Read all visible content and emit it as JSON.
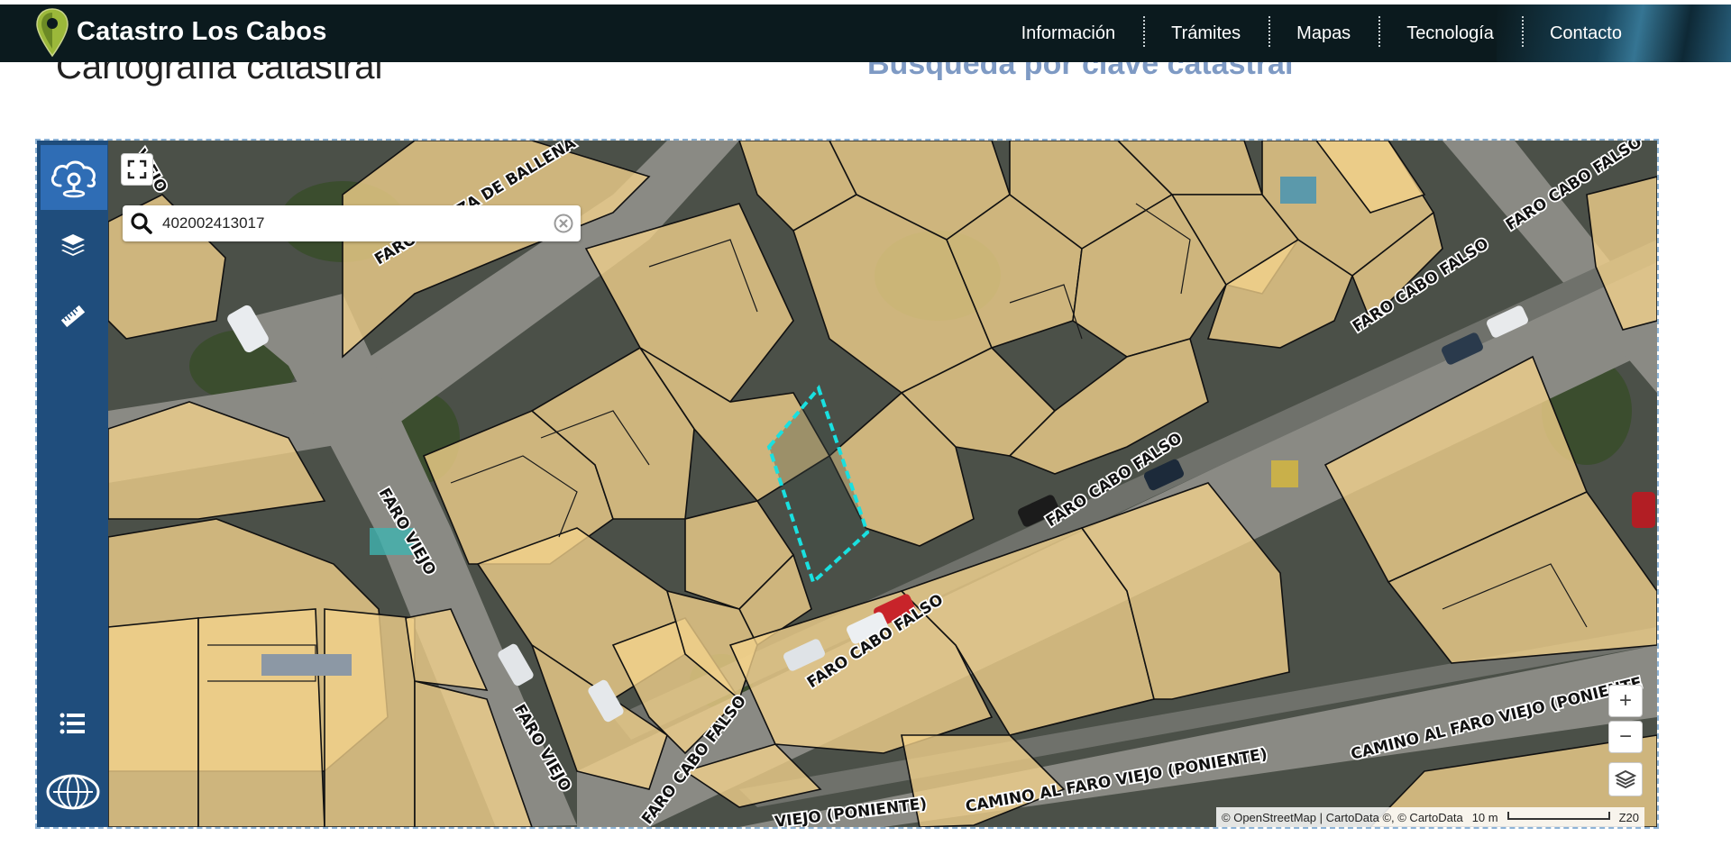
{
  "header": {
    "brand": "Catastro Los Cabos",
    "nav": [
      "Información",
      "Trámites",
      "Mapas",
      "Tecnología",
      "Contacto"
    ]
  },
  "page": {
    "left_heading": "Cartografía catastral",
    "right_heading": "Búsqueda por clave catastral"
  },
  "sidebar": {
    "icons": [
      "cloud-location-icon",
      "layers-icon",
      "ruler-icon",
      "list-icon",
      "logo-globe-icon"
    ]
  },
  "map": {
    "search_value": "402002413017",
    "streets": {
      "cabeza_de_ballena": "FARO CABEZA DE BALLENA",
      "cabo_falso": "FARO CABO FALSO",
      "faro_viejo": "FARO VIEJO",
      "camino_poniente": "CAMINO AL FARO VIEJO (PONIENTE",
      "camino_poniente_full": "CAMINO AL FARO VIEJO (PONIENTE)",
      "viejo_poniente": "VIEJO (PONIENTE)",
      "viejo_short": "VIEJO"
    },
    "zoom_in": "+",
    "zoom_out": "−",
    "attribution": "© OpenStreetMap | CartoData ©, © CartoData",
    "scale_label": "10 m",
    "zoom_level": "Z20",
    "colors": {
      "parcel_fill": "#f3d28c",
      "highlight": "#19e0e0",
      "sidebar": "#1f4d7c",
      "header": "#0b1a1e"
    }
  }
}
